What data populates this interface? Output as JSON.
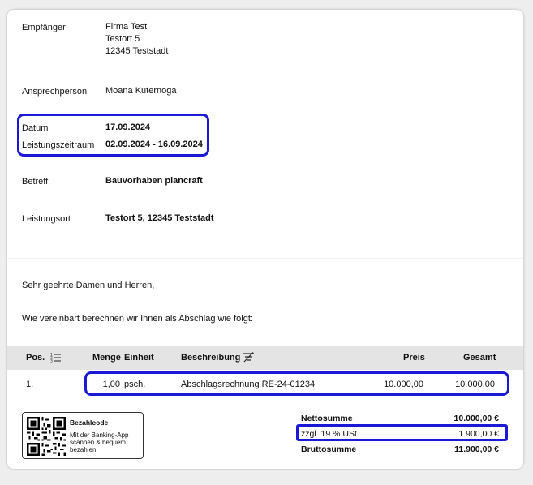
{
  "header": {
    "recipient_label": "Empfänger",
    "recipient_lines": [
      "Firma Test",
      "Testort 5",
      "12345 Teststadt"
    ],
    "contact_label": "Ansprechperson",
    "contact_value": "Moana Kuternoga",
    "date_label": "Datum",
    "date_value": "17.09.2024",
    "period_label": "Leistungszeitraum",
    "period_value": "02.09.2024 - 16.09.2024",
    "subject_label": "Betreff",
    "subject_value": "Bauvorhaben plancraft",
    "location_label": "Leistungsort",
    "location_value": "Testort 5, 12345 Teststadt"
  },
  "letter": {
    "greeting": "Sehr geehrte Damen und Herren,",
    "intro": "Wie vereinbart berechnen wir Ihnen als Abschlag wie folgt:"
  },
  "table": {
    "columns": {
      "pos": "Pos.",
      "menge": "Menge",
      "einheit": "Einheit",
      "beschreibung": "Beschreibung",
      "preis": "Preis",
      "gesamt": "Gesamt"
    },
    "rows": [
      {
        "pos": "1.",
        "menge": "1,00",
        "einheit": "psch.",
        "beschreibung": "Abschlagsrechnung RE-24-01234",
        "preis": "10.000,00",
        "gesamt": "10.000,00"
      }
    ]
  },
  "payment_code": {
    "title": "Bezahlcode",
    "text_lines": [
      "Mit der Banking-App",
      "scannen & bequem",
      "bezahlen."
    ]
  },
  "totals": {
    "net_label": "Nettosumme",
    "net_value": "10.000,00 €",
    "vat_label": "zzgl. 19 % USt.",
    "vat_value": "1.900,00 €",
    "gross_label": "Bruttosumme",
    "gross_value": "11.900,00 €"
  },
  "colors": {
    "highlight": "#1a1ad6",
    "table_header_bg": "#e4e4e4"
  },
  "icons": {
    "pos_column": "numbered-list-icon",
    "description_column": "filter-off-icon"
  }
}
